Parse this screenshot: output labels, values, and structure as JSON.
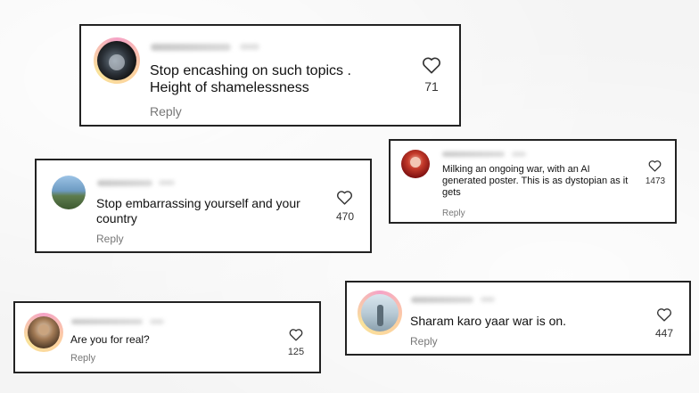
{
  "comments": [
    {
      "text": "Stop encashing on such topics . Height of shamelessness",
      "reply": "Reply",
      "likes": "71",
      "icon": "heart-outline"
    },
    {
      "text": "Milking an ongoing war, with an AI generated poster. This is as dystopian as it gets",
      "reply": "Reply",
      "likes": "1473",
      "icon": "heart-outline"
    },
    {
      "text": "Stop embarrassing yourself and your country",
      "reply": "Reply",
      "likes": "470",
      "icon": "heart-outline"
    },
    {
      "text": "Sharam karo yaar war is on.",
      "reply": "Reply",
      "likes": "447",
      "icon": "heart-outline"
    },
    {
      "text": "Are you for real?",
      "reply": "Reply",
      "likes": "125",
      "icon": "heart-outline"
    }
  ],
  "colors": {
    "border": "#222222",
    "reply": "#777777",
    "text": "#111111"
  }
}
